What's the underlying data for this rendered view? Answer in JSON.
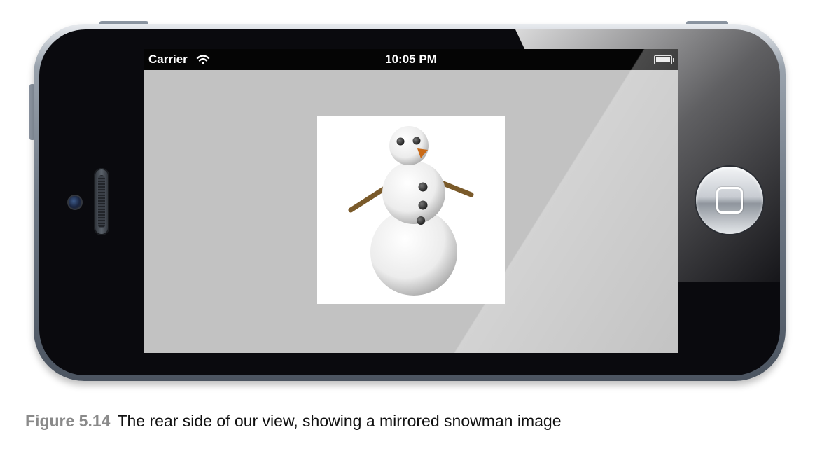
{
  "status_bar": {
    "carrier": "Carrier",
    "wifi_icon": "wifi-icon",
    "time": "10:05 PM",
    "battery_icon": "battery-icon"
  },
  "screen": {
    "background_color": "#c2c2c2",
    "image": {
      "description_icon": "mirrored-snowman-image",
      "background_color": "#ffffff"
    }
  },
  "device": {
    "home_button_icon": "home-button-icon",
    "front_camera_icon": "camera-icon",
    "speaker_icon": "speaker-icon"
  },
  "caption": {
    "figure_label": "Figure 5.14",
    "text": "The rear side of our view, showing a mirrored snowman image"
  }
}
